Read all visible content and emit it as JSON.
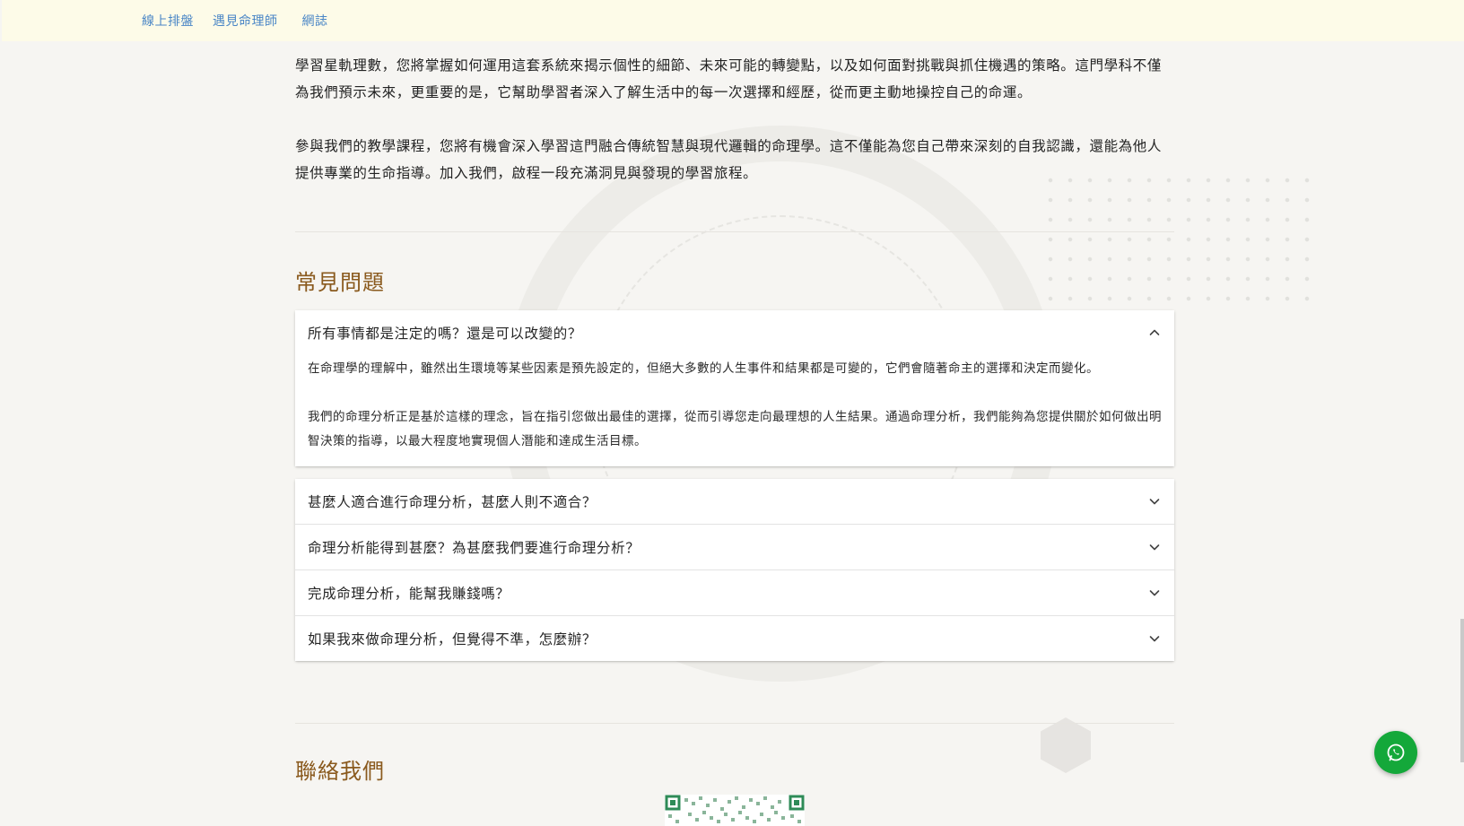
{
  "nav": {
    "items": [
      "線上排盤",
      "遇見命理師",
      "網誌"
    ]
  },
  "intro": {
    "paragraph1": "學習星軌理數，您將掌握如何運用這套系統來揭示個性的細節、未來可能的轉變點，以及如何面對挑戰與抓住機遇的策略。這門學科不僅為我們預示未來，更重要的是，它幫助學習者深入了解生活中的每一次選擇和經歷，從而更主動地操控自己的命運。",
    "paragraph2": "參與我們的教學課程，您將有機會深入學習這門融合傳統智慧與現代邏輯的命理學。這不僅能為您自己帶來深刻的自我認識，還能為他人提供專業的生命指導。加入我們，啟程一段充滿洞見與發現的學習旅程。"
  },
  "faq": {
    "title": "常見問題",
    "items": [
      {
        "question": "所有事情都是注定的嗎？還是可以改變的？",
        "expanded": true,
        "answer1": "在命理學的理解中，雖然出生環境等某些因素是預先設定的，但絕大多數的人生事件和結果都是可變的，它們會隨著命主的選擇和決定而變化。",
        "answer2": "我們的命理分析正是基於這樣的理念，旨在指引您做出最佳的選擇，從而引導您走向最理想的人生結果。通過命理分析，我們能夠為您提供關於如何做出明智決策的指導，以最大程度地實現個人潛能和達成生活目標。"
      },
      {
        "question": "甚麼人適合進行命理分析，甚麼人則不適合？",
        "expanded": false
      },
      {
        "question": "命理分析能得到甚麼？為甚麼我們要進行命理分析？",
        "expanded": false
      },
      {
        "question": "完成命理分析，能幫我賺錢嗎？",
        "expanded": false
      },
      {
        "question": "如果我來做命理分析，但覺得不準，怎麼辦？",
        "expanded": false
      }
    ]
  },
  "contact": {
    "title": "聯絡我們"
  },
  "colors": {
    "nav_bg": "#fdfbe8",
    "nav_link": "#4a86c6",
    "heading": "#8a5a1e",
    "whatsapp": "#14a83a"
  },
  "icons": {
    "expanded": "chevron-up-icon",
    "collapsed": "chevron-down-icon",
    "fab": "whatsapp-icon"
  }
}
